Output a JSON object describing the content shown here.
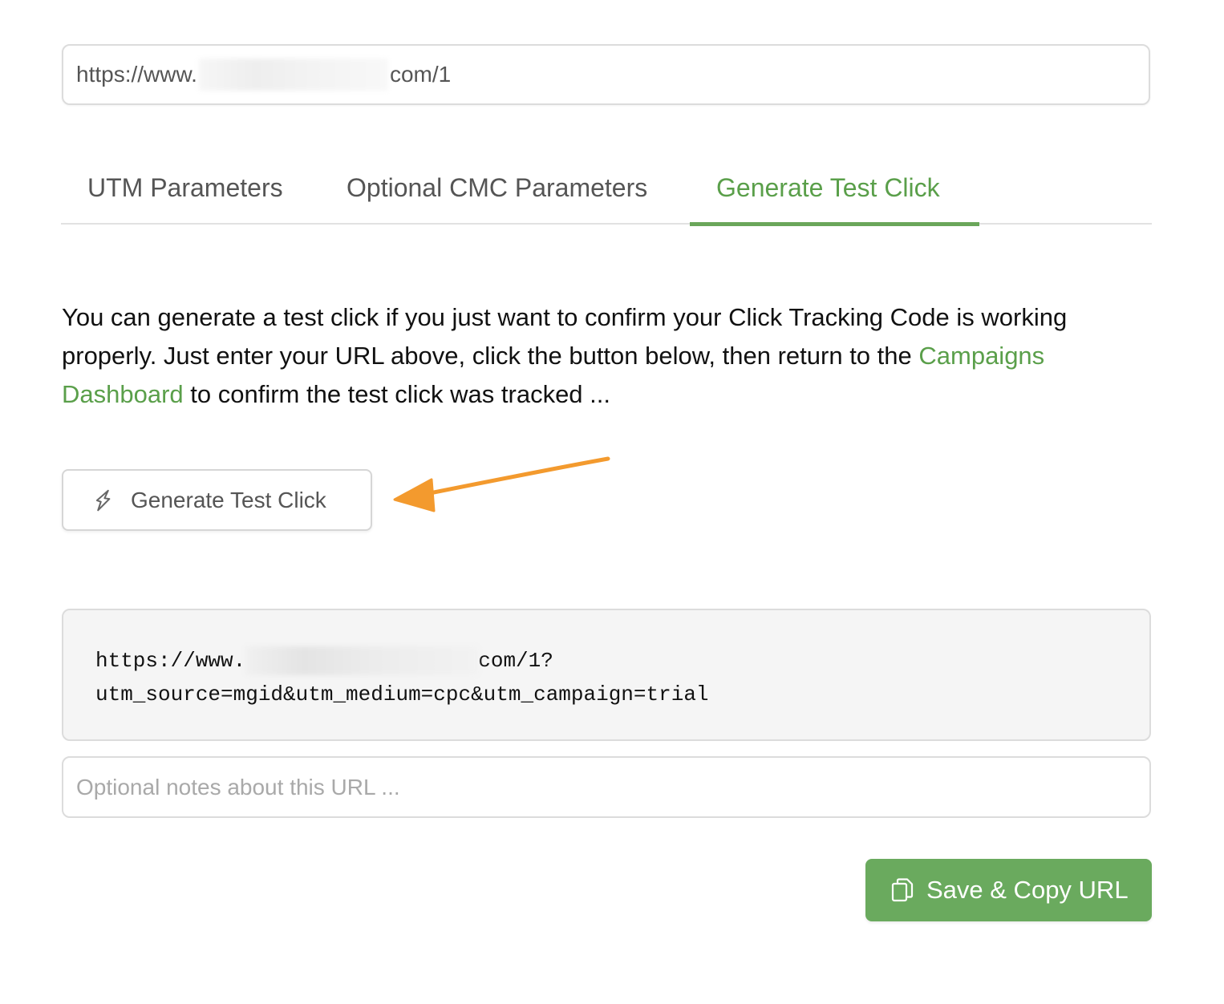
{
  "url_input": {
    "prefix": "https://www.",
    "suffix": "com/1"
  },
  "tabs": [
    {
      "label": "UTM Parameters",
      "active": false
    },
    {
      "label": "Optional CMC Parameters",
      "active": false
    },
    {
      "label": "Generate Test Click",
      "active": true
    }
  ],
  "description": {
    "text_before": "You can generate a test click if you just want to confirm your Click Tracking Code is working properly. Just enter your URL above, click the button below, then return to the ",
    "link_text": "Campaigns Dashboard",
    "text_after": " to confirm the test click was tracked ..."
  },
  "test_button": {
    "label": "Generate Test Click",
    "icon": "rocket-icon"
  },
  "annotation": {
    "icon": "arrow-icon",
    "color": "#f39a2e"
  },
  "generated_url": {
    "prefix": "https://www.",
    "suffix": "com/1?",
    "params": "utm_source=mgid&utm_medium=cpc&utm_campaign=trial"
  },
  "notes": {
    "placeholder": "Optional notes about this URL ..."
  },
  "save_button": {
    "label": "Save & Copy URL",
    "icon": "copy-icon"
  },
  "colors": {
    "accent": "#5a9f4a",
    "save_button_bg": "#6aaa5e",
    "arrow": "#f39a2e"
  }
}
